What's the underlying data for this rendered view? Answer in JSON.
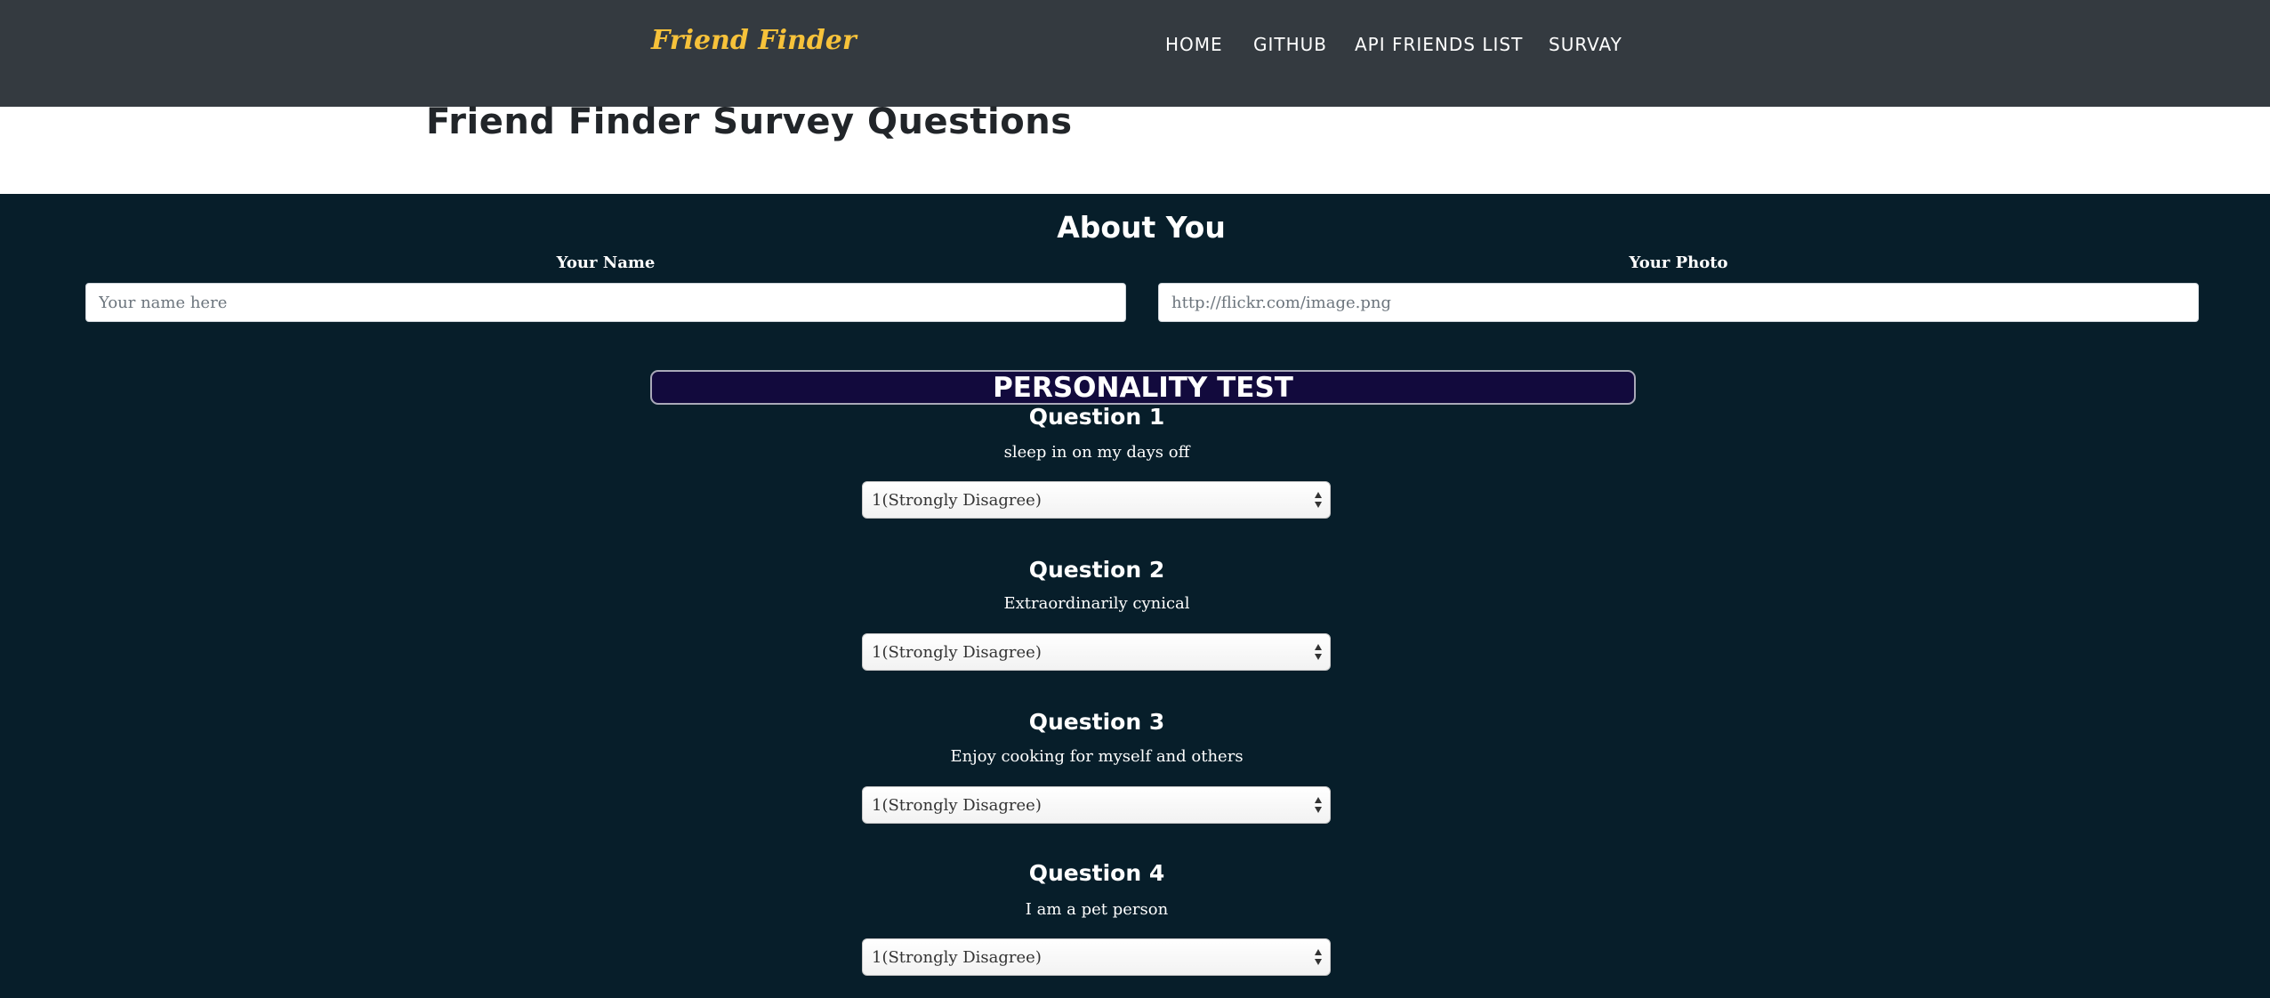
{
  "navbar": {
    "brand": "Friend Finder",
    "links": [
      {
        "label": "HOME"
      },
      {
        "label": "GITHUB"
      },
      {
        "label": "API FRIENDS LIST"
      },
      {
        "label": "SURVAY"
      }
    ]
  },
  "page_title": "Friend Finder Survey Questions",
  "about": {
    "title": "About You",
    "name_label": "Your Name",
    "name_placeholder": "Your name here",
    "photo_label": "Your Photo",
    "photo_placeholder": "http://flickr.com/image.png"
  },
  "personality": {
    "title": "PERSONALITY TEST",
    "questions": [
      {
        "title": "Question 1",
        "text": "sleep in on my days off",
        "selected": "1(Strongly Disagree)"
      },
      {
        "title": "Question 2",
        "text": "Extraordinarily cynical",
        "selected": "1(Strongly Disagree)"
      },
      {
        "title": "Question 3",
        "text": "Enjoy cooking for myself and others",
        "selected": "1(Strongly Disagree)"
      },
      {
        "title": "Question 4",
        "text": "I am a pet person",
        "selected": "1(Strongly Disagree)"
      }
    ]
  },
  "colors": {
    "navbar_bg": "#343a40",
    "brand": "#f7c23a",
    "main_bg": "#071e2a",
    "banner_bg": "#120a3d"
  }
}
